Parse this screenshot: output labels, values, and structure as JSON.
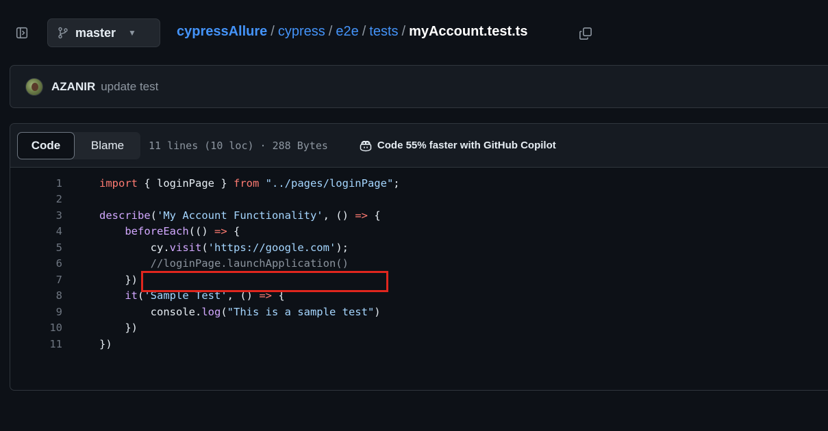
{
  "branch": {
    "name": "master"
  },
  "breadcrumb": {
    "repo": "cypressAllure",
    "dirs": [
      "cypress",
      "e2e",
      "tests"
    ],
    "file": "myAccount.test.ts",
    "separator": "/"
  },
  "commit": {
    "author": "AZANIR",
    "message": "update test"
  },
  "file_header": {
    "code_tab": "Code",
    "blame_tab": "Blame",
    "meta": "11 lines (10 loc) · 288 Bytes",
    "copilot": "Code 55% faster with GitHub Copilot"
  },
  "code": {
    "lines": [
      {
        "n": "1",
        "tokens": [
          [
            "kw",
            "import"
          ],
          [
            "p",
            " { loginPage } "
          ],
          [
            "kw",
            "from"
          ],
          [
            "p",
            " "
          ],
          [
            "str",
            "\"../pages/loginPage\""
          ],
          [
            "p",
            ";"
          ]
        ]
      },
      {
        "n": "2",
        "tokens": []
      },
      {
        "n": "3",
        "tokens": [
          [
            "fn",
            "describe"
          ],
          [
            "p",
            "("
          ],
          [
            "str",
            "'My Account Functionality'"
          ],
          [
            "p",
            ", () "
          ],
          [
            "kw",
            "=>"
          ],
          [
            "p",
            " {"
          ]
        ]
      },
      {
        "n": "4",
        "tokens": [
          [
            "p",
            "    "
          ],
          [
            "fn",
            "beforeEach"
          ],
          [
            "p",
            "(() "
          ],
          [
            "kw",
            "=>"
          ],
          [
            "p",
            " {"
          ]
        ]
      },
      {
        "n": "5",
        "tokens": [
          [
            "p",
            "        cy."
          ],
          [
            "fn",
            "visit"
          ],
          [
            "p",
            "("
          ],
          [
            "str",
            "'https://google.com'"
          ],
          [
            "p",
            ");"
          ]
        ]
      },
      {
        "n": "6",
        "tokens": [
          [
            "p",
            "        "
          ],
          [
            "cm",
            "//loginPage.launchApplication()"
          ]
        ]
      },
      {
        "n": "7",
        "tokens": [
          [
            "p",
            "    })"
          ]
        ]
      },
      {
        "n": "8",
        "tokens": [
          [
            "p",
            "    "
          ],
          [
            "fn",
            "it"
          ],
          [
            "p",
            "("
          ],
          [
            "str",
            "'Sample Test'"
          ],
          [
            "p",
            ", () "
          ],
          [
            "kw",
            "=>"
          ],
          [
            "p",
            " {"
          ]
        ]
      },
      {
        "n": "9",
        "tokens": [
          [
            "p",
            "        console."
          ],
          [
            "fn",
            "log"
          ],
          [
            "p",
            "("
          ],
          [
            "str",
            "\"This is a sample test\""
          ],
          [
            "p",
            ")"
          ]
        ]
      },
      {
        "n": "10",
        "tokens": [
          [
            "p",
            "    })"
          ]
        ]
      },
      {
        "n": "11",
        "tokens": [
          [
            "p",
            "})"
          ]
        ]
      }
    ]
  },
  "colors": {
    "background": "#0d1117",
    "link": "#4493f8",
    "keyword": "#ff7b72",
    "string": "#a5d6ff",
    "function": "#d2a8ff",
    "comment": "#8b949e",
    "annotation_box": "#e0261e"
  },
  "icons": {
    "sidebar_toggle": "sidebar-collapse-icon",
    "branch": "git-branch-icon",
    "caret": "triangle-down-icon",
    "copy": "copy-icon",
    "copilot": "copilot-icon"
  }
}
